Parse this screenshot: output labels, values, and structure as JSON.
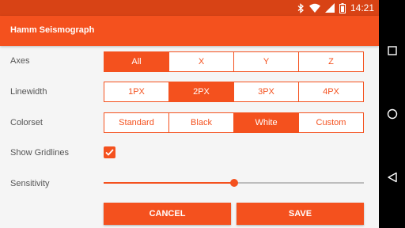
{
  "status_bar": {
    "time": "14:21",
    "icons": [
      "bluetooth-icon",
      "wifi-icon",
      "signal-icon",
      "battery-icon"
    ]
  },
  "app": {
    "title": "Hamm Seismograph"
  },
  "axes": {
    "label": "Axes",
    "options": [
      "All",
      "X",
      "Y",
      "Z"
    ],
    "selected": "All"
  },
  "linewidth": {
    "label": "Linewidth",
    "options": [
      "1PX",
      "2PX",
      "3PX",
      "4PX"
    ],
    "selected": "2PX"
  },
  "colorset": {
    "label": "Colorset",
    "options": [
      "Standard",
      "Black",
      "White",
      "Custom"
    ],
    "selected": "White"
  },
  "gridlines": {
    "label": "Show Gridlines",
    "checked": true
  },
  "sensitivity": {
    "label": "Sensitivity",
    "value": 0.5
  },
  "actions": {
    "cancel": "CANCEL",
    "save": "SAVE"
  },
  "nav": {
    "icons": [
      "recents-icon",
      "home-icon",
      "back-icon"
    ]
  },
  "colors": {
    "accent": "#f4511e",
    "status_bar": "#d84315"
  }
}
